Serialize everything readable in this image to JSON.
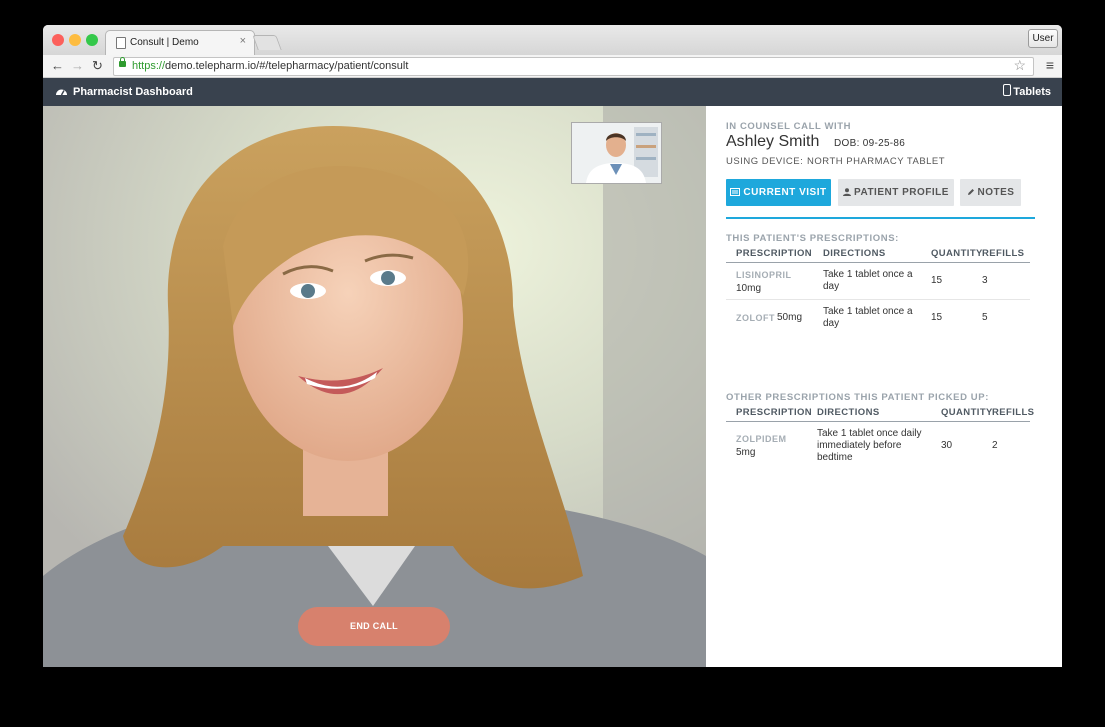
{
  "browser": {
    "tab_title": "Consult | Demo",
    "tab_close": "×",
    "user_button": "User",
    "url_scheme": "https://",
    "url_rest": "demo.telepharm.io/#/telepharmacy/patient/consult",
    "back_icon": "←",
    "forward_icon": "→",
    "reload_icon": "↻",
    "star_icon": "☆",
    "menu_icon": "≡",
    "traffic_lights": [
      "#fc605b",
      "#fdbc40",
      "#34c84a"
    ]
  },
  "app": {
    "title": "Pharmacist Dashboard",
    "tablets_label": "Tablets"
  },
  "call": {
    "end_call_label": "END CALL"
  },
  "panel": {
    "in_call_caption": "IN COUNSEL CALL WITH",
    "patient_name": "Ashley Smith",
    "dob": "DOB: 09-25-86",
    "device_caption": "USING DEVICE:",
    "device_name": "NORTH PHARMACY TABLET",
    "accent_color": "#1ea8dc",
    "tabs": [
      {
        "label": "CURRENT VISIT",
        "active": true
      },
      {
        "label": "PATIENT PROFILE",
        "active": false
      },
      {
        "label": "NOTES",
        "active": false
      }
    ],
    "prescriptions": {
      "caption": "THIS PATIENT'S PRESCRIPTIONS:",
      "headers": [
        "PRESCRIPTION",
        "DIRECTIONS",
        "QUANTITY",
        "REFILLS"
      ],
      "rows": [
        {
          "name": "LISINOPRIL",
          "dose": "10mg",
          "directions": [
            "Take 1 tablet once a",
            "day"
          ],
          "quantity": "15",
          "refills": "3"
        },
        {
          "name": "ZOLOFT",
          "dose": "50mg",
          "directions": [
            "Take 1 tablet once a",
            "day"
          ],
          "quantity": "15",
          "refills": "5"
        }
      ]
    },
    "other": {
      "caption": "OTHER PRESCRIPTIONS THIS PATIENT PICKED UP:",
      "headers": [
        "PRESCRIPTION",
        "DIRECTIONS",
        "QUANTITY",
        "REFILLS"
      ],
      "rows": [
        {
          "name": "ZOLPIDEM",
          "dose": "5mg",
          "directions": [
            "Take 1 tablet once daily",
            "immediately before",
            "bedtime"
          ],
          "quantity": "30",
          "refills": "2"
        }
      ]
    }
  }
}
